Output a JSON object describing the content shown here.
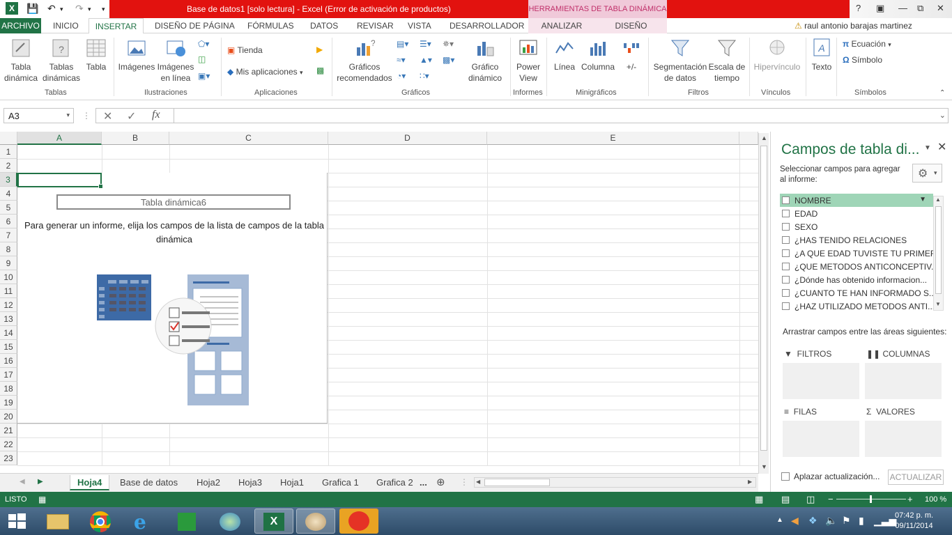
{
  "window": {
    "title": "Base de datos1  [solo lectura]  -  Excel (Error de activación de productos)",
    "context_tools": "HERRAMIENTAS DE TABLA DINÁMICA",
    "user": "raul antonio barajas martinez"
  },
  "tabs": {
    "file": "ARCHIVO",
    "items": [
      "INICIO",
      "INSERTAR",
      "DISEÑO DE PÁGINA",
      "FÓRMULAS",
      "DATOS",
      "REVISAR",
      "VISTA",
      "DESARROLLADOR"
    ],
    "context": [
      "ANALIZAR",
      "DISEÑO"
    ],
    "active": "INSERTAR"
  },
  "ribbon": {
    "tablas": {
      "label": "Tablas",
      "pivot": "Tabla dinámica",
      "recommended": "Tablas dinámicas",
      "table": "Tabla"
    },
    "ilustraciones": {
      "label": "Ilustraciones",
      "images": "Imágenes",
      "online": "Imágenes en línea"
    },
    "aplicaciones": {
      "label": "Aplicaciones",
      "store": "Tienda",
      "myapps": "Mis aplicaciones"
    },
    "graficos": {
      "label": "Gráficos",
      "recommended": "Gráficos recomendados",
      "pivotchart": "Gráfico dinámico"
    },
    "informes": {
      "label": "Informes",
      "powerview": "Power View"
    },
    "minigraficos": {
      "label": "Minigráficos",
      "line": "Línea",
      "column": "Columna",
      "winloss": "+/-"
    },
    "filtros": {
      "label": "Filtros",
      "slicer": "Segmentación de datos",
      "timeline": "Escala de tiempo"
    },
    "vinculos": {
      "label": "Vínculos",
      "hyperlink": "Hipervínculo"
    },
    "texto": {
      "text": "Texto"
    },
    "simbolos": {
      "label": "Símbolos",
      "equation": "Ecuación",
      "symbol": "Símbolo"
    }
  },
  "formula_bar": {
    "namebox": "A3",
    "fx": "fx",
    "value": ""
  },
  "grid": {
    "columns": [
      "A",
      "B",
      "C",
      "D",
      "E"
    ],
    "rows": [
      "1",
      "2",
      "3",
      "4",
      "5",
      "6",
      "7",
      "8",
      "9",
      "10",
      "11",
      "12",
      "13",
      "14",
      "15",
      "16",
      "17",
      "18",
      "19",
      "20",
      "21",
      "22",
      "23"
    ],
    "selected_cell": "A3",
    "pivot_name": "Tabla dinámica6",
    "pivot_message": "Para generar un informe, elija los campos de la lista de campos de la tabla dinámica"
  },
  "sheets": {
    "tabs": [
      "Hoja4",
      "Base de datos",
      "Hoja2",
      "Hoja3",
      "Hoja1",
      "Grafica 1",
      "Grafica 2"
    ],
    "more": "...",
    "active": "Hoja4"
  },
  "pivot_pane": {
    "title": "Campos de tabla di...",
    "subtitle": "Seleccionar campos para agregar al informe:",
    "fields": [
      "NOMBRE",
      "EDAD",
      "SEXO",
      "¿HAS TENIDO RELACIONES",
      "¿A QUE EDAD TUVISTE TU PRIMER...",
      "¿QUE METODOS ANTICONCEPTIV...",
      "¿Dónde has obtenido  informacion...",
      "¿CUANTO TE HAN INFORMADO S...",
      "¿HAZ UTILIZADO METODOS ANTI..."
    ],
    "highlighted_field": "NOMBRE",
    "drag_label": "Arrastrar campos entre las áreas siguientes:",
    "areas": {
      "filters": "FILTROS",
      "columns": "COLUMNAS",
      "rows": "FILAS",
      "values": "VALORES"
    },
    "defer": "Aplazar actualización...",
    "update": "ACTUALIZAR"
  },
  "status": {
    "ready": "LISTO",
    "zoom": "100 %"
  },
  "taskbar": {
    "time": "07:42 p. m.",
    "date": "09/11/2014"
  },
  "colors": {
    "excel_green": "#217346",
    "title_red": "#e2120f",
    "context_pink": "#f0c9d9",
    "field_highlight": "#9fd5b7"
  }
}
